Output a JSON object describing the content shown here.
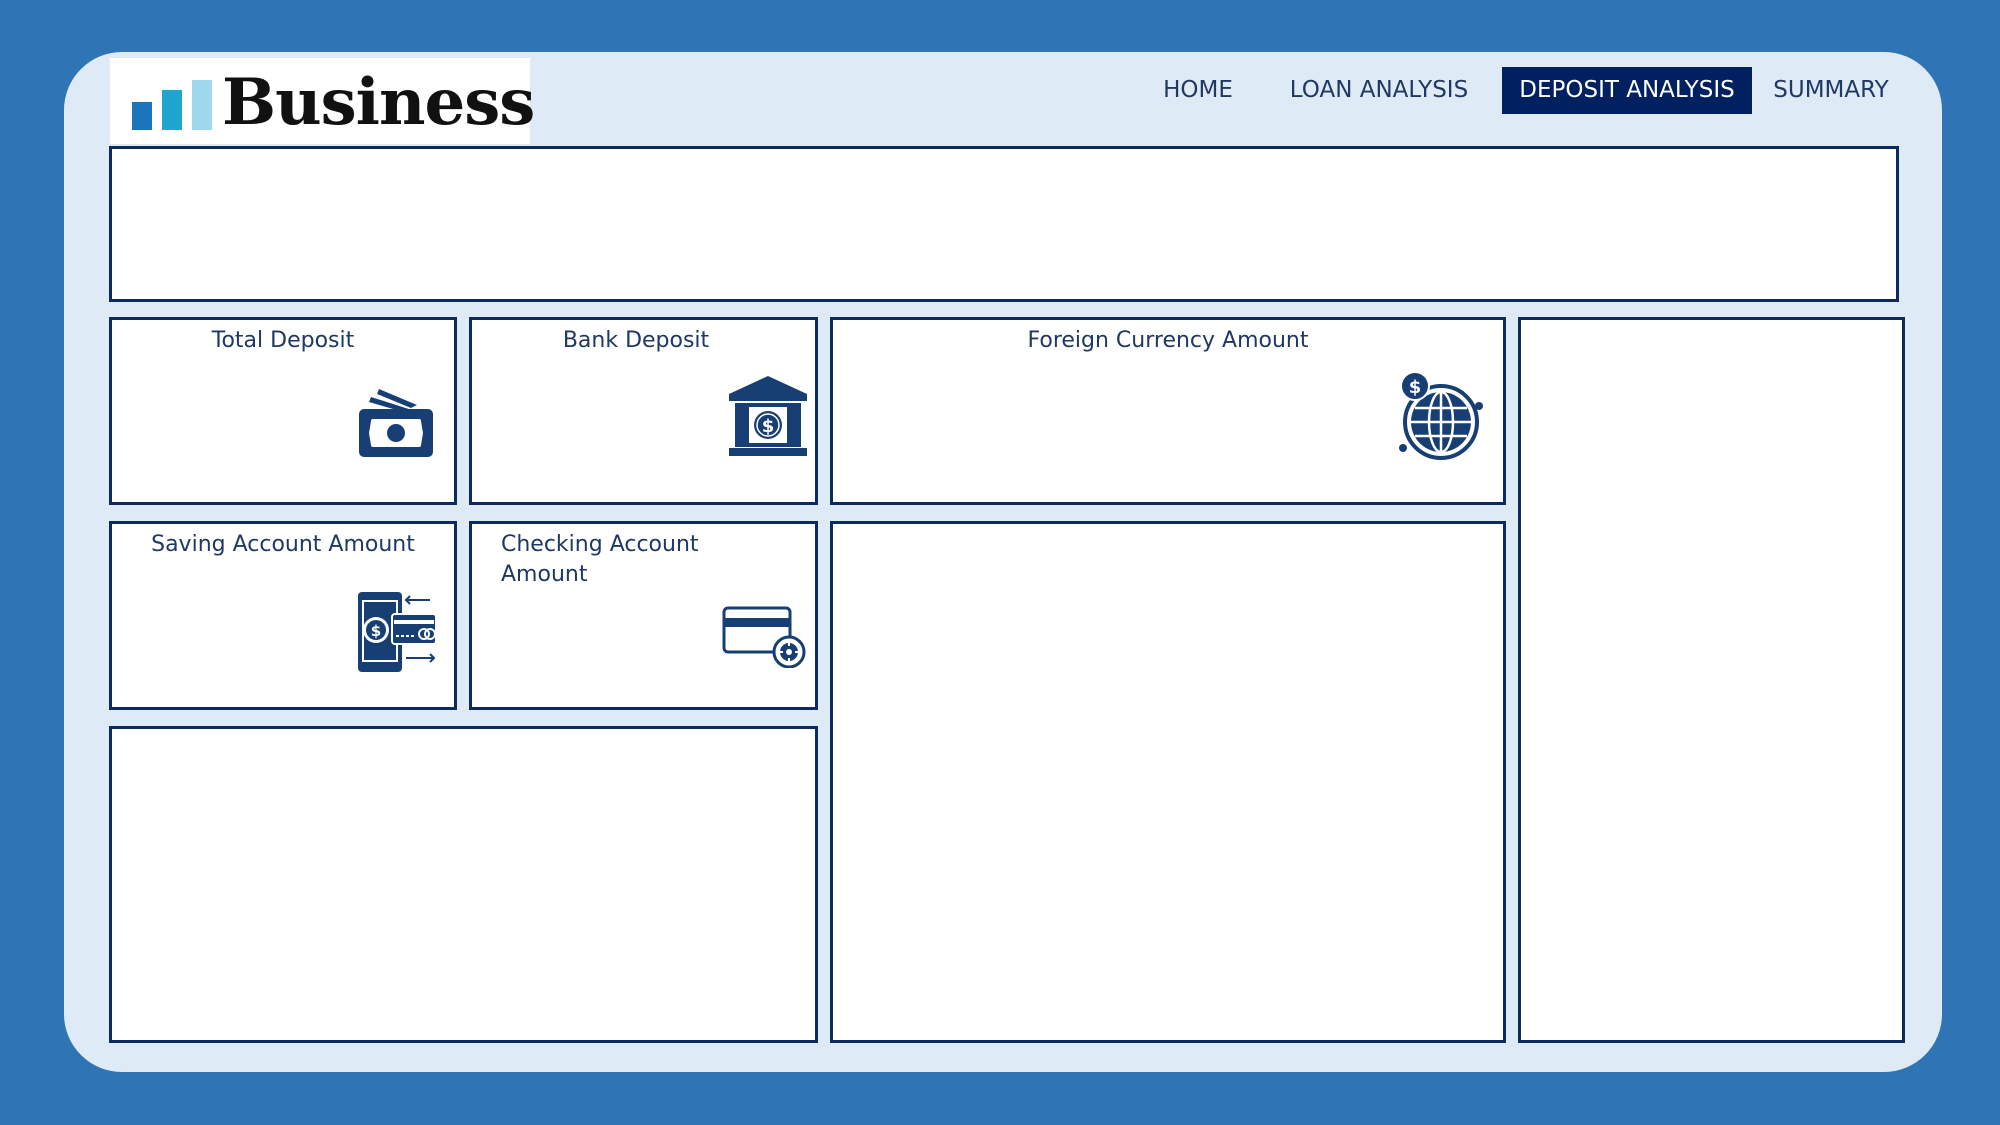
{
  "header": {
    "logo_text": "Business",
    "logo_colors": [
      "#1b75bb",
      "#1ea5d0",
      "#9dd9ea"
    ]
  },
  "nav": {
    "items": [
      {
        "label": "HOME",
        "active": false
      },
      {
        "label": "LOAN ANALYSIS",
        "active": false
      },
      {
        "label": "DEPOSIT ANALYSIS",
        "active": true
      },
      {
        "label": "SUMMARY",
        "active": false
      }
    ]
  },
  "cards": {
    "total_deposit": {
      "title": "Total Deposit",
      "icon": "cash-stack-icon"
    },
    "bank_deposit": {
      "title": "Bank Deposit",
      "icon": "bank-icon"
    },
    "foreign_currency": {
      "title": "Foreign Currency Amount",
      "icon": "globe-dollar-icon"
    },
    "saving_account": {
      "title": "Saving Account Amount",
      "icon": "mobile-payment-icon"
    },
    "checking_account": {
      "title": "Checking Account\nAmount",
      "icon": "credit-card-gear-icon"
    }
  },
  "colors": {
    "background": "#2f75b5",
    "canvas": "#deeaf6",
    "border": "#0d2a5c",
    "active_nav": "#002060",
    "text": "#1f3864",
    "icon": "#173f73"
  }
}
